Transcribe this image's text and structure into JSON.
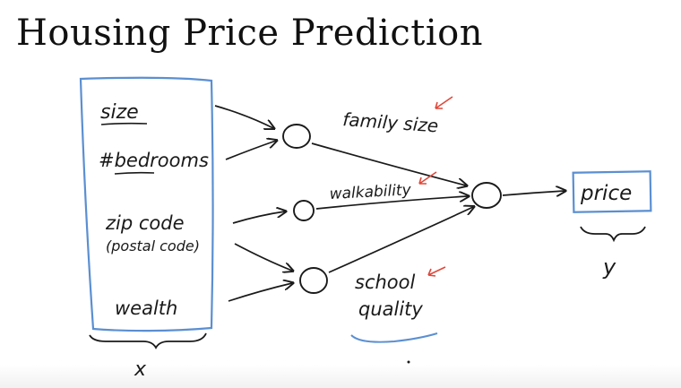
{
  "title": "Housing Price Prediction",
  "inputs": {
    "size": "size",
    "bedrooms": "#bedrooms",
    "zip_code": "zip code",
    "postal_code": "(postal code)",
    "wealth": "wealth",
    "group_label": "x"
  },
  "hidden_labels": {
    "family_size": "family size",
    "walkability": "walkability",
    "school": "school",
    "quality": "quality"
  },
  "output": {
    "price": "price",
    "label": "y"
  },
  "colors": {
    "ink": "#1a1a1a",
    "box_blue": "#5b8fd1",
    "arrow_red": "#e0483a"
  }
}
